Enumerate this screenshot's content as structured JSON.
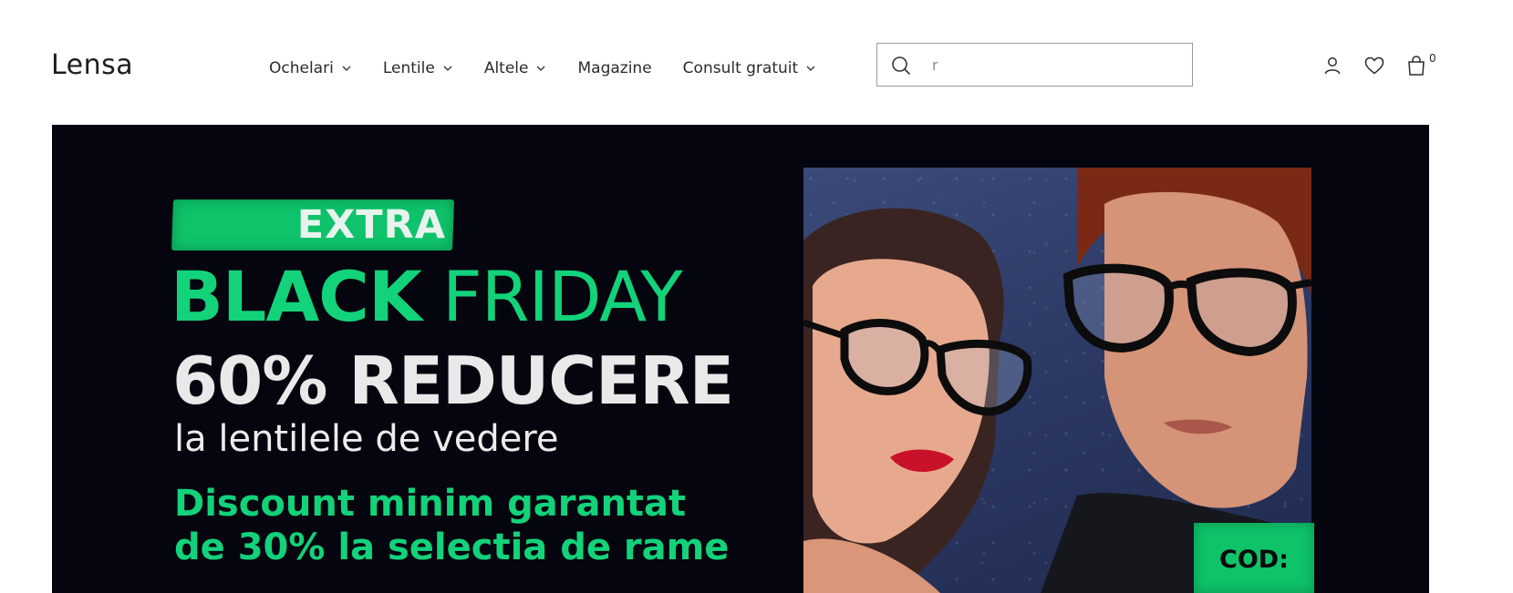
{
  "brand": {
    "logo_text": "Lens",
    "logo_tail": "a"
  },
  "nav": {
    "items": [
      {
        "label": "Ochelari",
        "has_dropdown": true
      },
      {
        "label": "Lentile",
        "has_dropdown": true
      },
      {
        "label": "Altele",
        "has_dropdown": true
      },
      {
        "label": "Magazine",
        "has_dropdown": false
      },
      {
        "label": "Consult gratuit",
        "has_dropdown": true
      }
    ]
  },
  "search": {
    "value": "r",
    "icon": "search-icon"
  },
  "header_actions": {
    "account_icon": "user-icon",
    "wishlist_icon": "heart-icon",
    "cart_icon": "shopping-bag-icon",
    "cart_count": "0"
  },
  "hero": {
    "extra": "EXTRA",
    "black": "BLACK",
    "friday": "FRIDAY",
    "headline": "60% REDUCERE",
    "subline": "la lentilele de vedere",
    "discount_line1": "Discount minim garantat",
    "discount_line2": "de 30% la selectia de rame",
    "code_label": "COD:",
    "colors": {
      "background": "#05050f",
      "accent_green": "#12d27a"
    }
  }
}
